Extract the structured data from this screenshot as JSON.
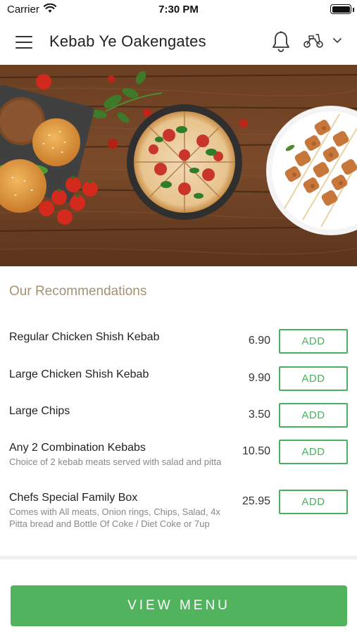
{
  "status_bar": {
    "carrier": "Carrier",
    "time": "7:30 PM"
  },
  "header": {
    "title": "Kebab Ye Oakengates",
    "icons": [
      "hamburger-menu-icon",
      "bell-icon",
      "scooter-icon",
      "chevron-down-icon"
    ]
  },
  "hero": {
    "image": "food-banner-burgers-pizza-kebab-skewers"
  },
  "recommendations": {
    "title": "Our Recommendations",
    "items": [
      {
        "name": "Regular Chicken Shish Kebab",
        "description": "",
        "price": "6.90",
        "add_label": "ADD"
      },
      {
        "name": "Large Chicken Shish Kebab",
        "description": "",
        "price": "9.90",
        "add_label": "ADD"
      },
      {
        "name": "Large Chips",
        "description": "",
        "price": "3.50",
        "add_label": "ADD"
      },
      {
        "name": "Any 2 Combination Kebabs",
        "description": "Choice of 2 kebab meats served with salad and pitta",
        "price": "10.50",
        "add_label": "ADD"
      },
      {
        "name": "Chefs Special Family Box",
        "description": "Comes with All meats, Onion rings, Chips, Salad, 4x Pitta bread and Bottle Of Coke / Diet Coke or 7up",
        "price": "25.95",
        "add_label": "ADD"
      }
    ]
  },
  "footer": {
    "view_menu_label": "VIEW MENU"
  },
  "colors": {
    "accent_green": "#52b35f",
    "section_title": "#a59273"
  }
}
